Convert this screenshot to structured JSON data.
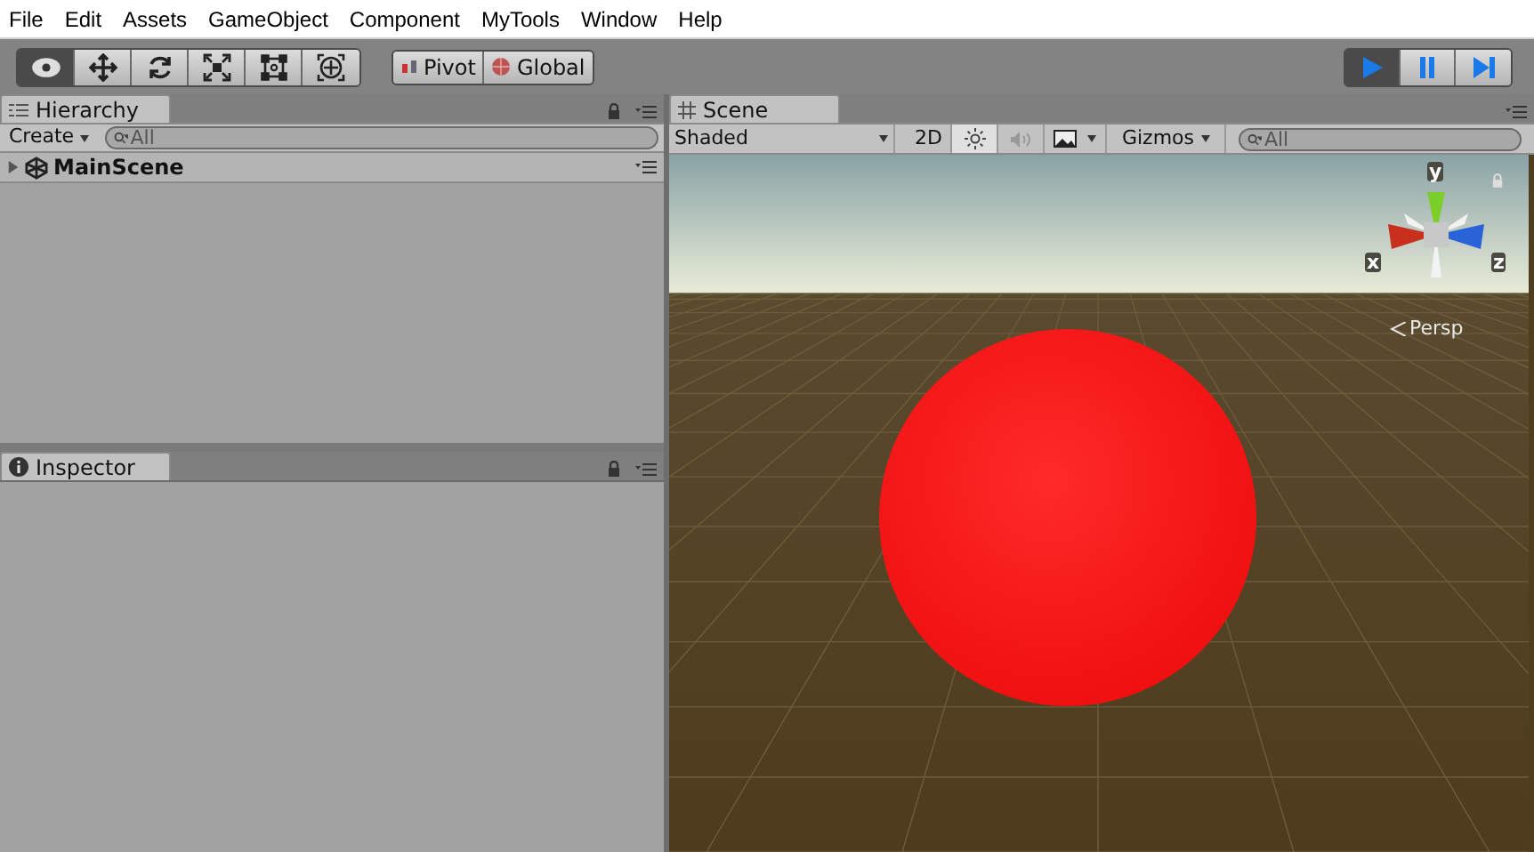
{
  "menu": [
    "File",
    "Edit",
    "Assets",
    "GameObject",
    "Component",
    "MyTools",
    "Window",
    "Help"
  ],
  "tools": [
    {
      "kind": "view",
      "selected": true
    },
    {
      "kind": "move",
      "selected": false
    },
    {
      "kind": "rotate",
      "selected": false
    },
    {
      "kind": "scale",
      "selected": false
    },
    {
      "kind": "rect",
      "selected": false
    },
    {
      "kind": "transform",
      "selected": false
    }
  ],
  "pivot_buttons": [
    {
      "kind": "pivot",
      "label": "Pivot"
    },
    {
      "kind": "global",
      "label": "Global"
    }
  ],
  "play_controls": [
    {
      "kind": "play",
      "selected": true
    },
    {
      "kind": "pause",
      "selected": false
    },
    {
      "kind": "step",
      "selected": false
    }
  ],
  "hierarchy": {
    "tab": "Hierarchy",
    "create": "Create",
    "search_placeholder": "All",
    "scene": {
      "name": "MainScene",
      "expanded": false
    }
  },
  "inspector": {
    "tab": "Inspector"
  },
  "scene_view": {
    "tab": "Scene",
    "shading": "Shaded",
    "mode_2d": "2D",
    "lighting": true,
    "audio": false,
    "gizmos": "Gizmos",
    "search_placeholder": "All",
    "axes": [
      "y",
      "x",
      "z"
    ],
    "projection": "Persp"
  }
}
